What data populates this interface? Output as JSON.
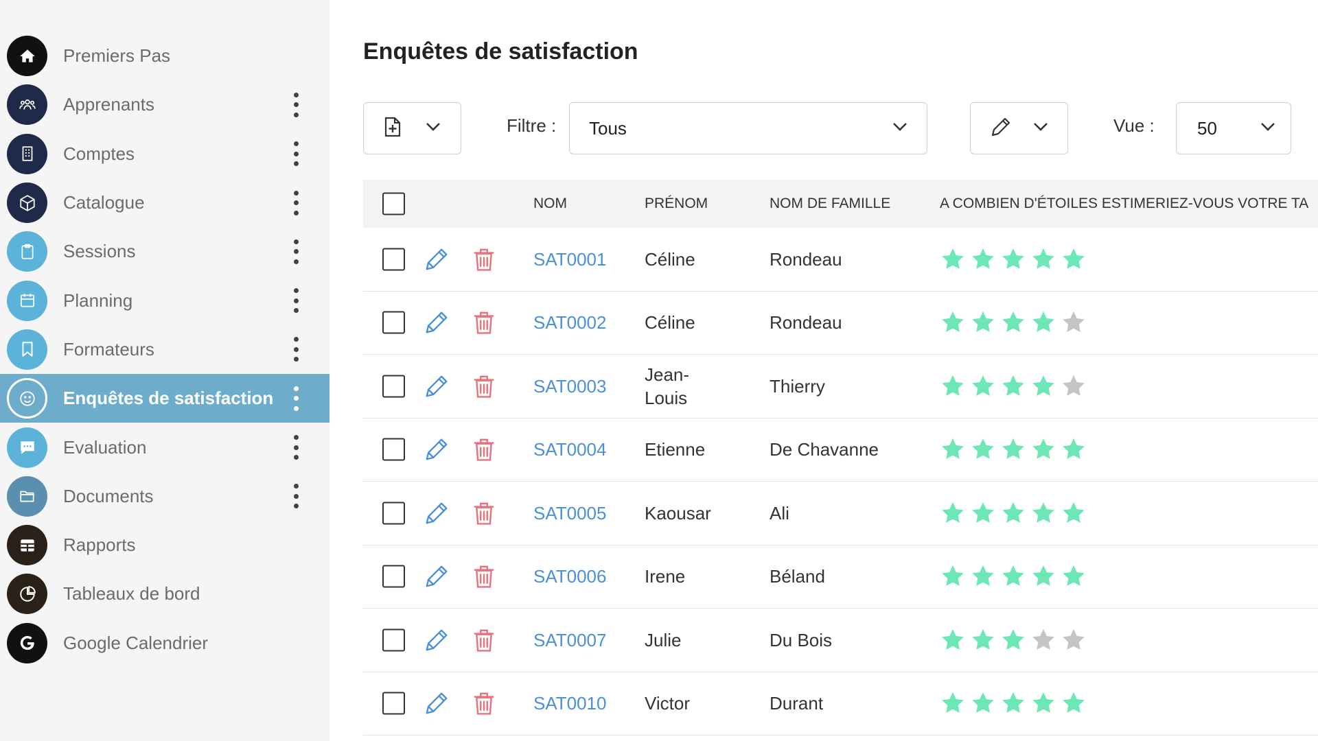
{
  "sidebar": {
    "items": [
      {
        "label": "Premiers Pas",
        "icon": "home-icon",
        "color": "#111111",
        "menu": false,
        "active": false
      },
      {
        "label": "Apprenants",
        "icon": "group-icon",
        "color": "#1f2a4a",
        "menu": true,
        "active": false
      },
      {
        "label": "Comptes",
        "icon": "building-icon",
        "color": "#1f2a4a",
        "menu": true,
        "active": false
      },
      {
        "label": "Catalogue",
        "icon": "cube-icon",
        "color": "#1f2a4a",
        "menu": true,
        "active": false
      },
      {
        "label": "Sessions",
        "icon": "clipboard-icon",
        "color": "#5bb3d9",
        "menu": true,
        "active": false
      },
      {
        "label": "Planning",
        "icon": "calendar-icon",
        "color": "#5bb3d9",
        "menu": true,
        "active": false
      },
      {
        "label": "Formateurs",
        "icon": "bookmark-icon",
        "color": "#5bb3d9",
        "menu": true,
        "active": false
      },
      {
        "label": "Enquêtes de satisfaction",
        "icon": "smiley-icon",
        "color": "#6dadcb",
        "menu": true,
        "active": true
      },
      {
        "label": "Evaluation",
        "icon": "chat-icon",
        "color": "#5bb3d9",
        "menu": true,
        "active": false
      },
      {
        "label": "Documents",
        "icon": "folder-icon",
        "color": "#5a8fb0",
        "menu": true,
        "active": false
      },
      {
        "label": "Rapports",
        "icon": "table-icon",
        "color": "#2a2118",
        "menu": false,
        "active": false
      },
      {
        "label": "Tableaux de bord",
        "icon": "pie-chart-icon",
        "color": "#2a2118",
        "menu": false,
        "active": false
      },
      {
        "label": "Google Calendrier",
        "icon": "google-icon",
        "color": "#111111",
        "menu": false,
        "active": false
      }
    ]
  },
  "main": {
    "title": "Enquêtes de satisfaction",
    "filter_label": "Filtre :",
    "filter_value": "Tous",
    "view_label": "Vue :",
    "view_value": "50"
  },
  "table": {
    "columns": [
      "NOM",
      "PRÉNOM",
      "NOM DE FAMILLE",
      "A COMBIEN D'ÉTOILES ESTIMERIEZ-VOUS VOTRE TA"
    ],
    "rows": [
      {
        "nom": "SAT0001",
        "prenom": "Céline",
        "famille": "Rondeau",
        "stars": 5
      },
      {
        "nom": "SAT0002",
        "prenom": "Céline",
        "famille": "Rondeau",
        "stars": 4
      },
      {
        "nom": "SAT0003",
        "prenom": "Jean-\nLouis",
        "famille": "Thierry",
        "stars": 4
      },
      {
        "nom": "SAT0004",
        "prenom": "Etienne",
        "famille": "De Chavanne",
        "stars": 5
      },
      {
        "nom": "SAT0005",
        "prenom": "Kaousar",
        "famille": "Ali",
        "stars": 5
      },
      {
        "nom": "SAT0006",
        "prenom": "Irene",
        "famille": "Béland",
        "stars": 5
      },
      {
        "nom": "SAT0007",
        "prenom": "Julie",
        "famille": "Du Bois",
        "stars": 3
      },
      {
        "nom": "SAT0010",
        "prenom": "Victor",
        "famille": "Durant",
        "stars": 5
      }
    ]
  },
  "colors": {
    "star_on": "#6ee7b7",
    "star_off": "#c4c4c4",
    "link": "#4a90d9",
    "edit": "#4a90d9",
    "delete": "#e8707a",
    "active_bg": "#6dadcb"
  }
}
